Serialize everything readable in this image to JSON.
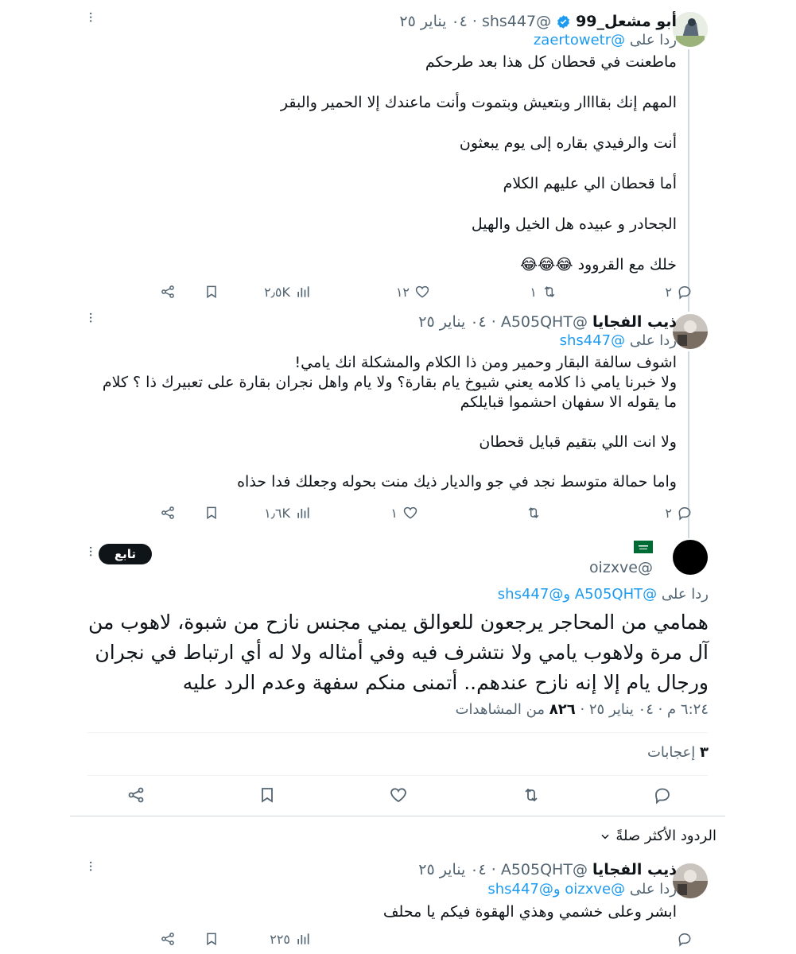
{
  "tweets": [
    {
      "name": "أبو مشعل_99",
      "handle": "@shs447",
      "date": "٠٤ يناير ٢٥",
      "reply_label": "ردا على",
      "reply_to": "@zaertowetr",
      "paragraphs": [
        "ماطعنت في قحطان كل هذا بعد طرحكم",
        "المهم إنك بقاااار وبتعيش وبتموت وأنت ماعندك إلا الحمير والبقر",
        "أنت والرفيدي بقاره إلى يوم يبعثون",
        "أما قحطان الي عليهم الكلام",
        "الجحادر و عبيده هل الخيل والهيل",
        "خلك مع القروود 😂😂😂"
      ],
      "replies": "٢",
      "retweets": "١",
      "likes": "١٢",
      "views": "٢٫٥K"
    },
    {
      "name": "ذيب الفجايا",
      "handle": "@A505QHT",
      "date": "٠٤ يناير ٢٥",
      "reply_label": "ردا على",
      "reply_to": "@shs447",
      "paragraphs": [
        "اشوف سالفة البقار وحمير ومن ذا الكلام والمشكلة انك يامي!\nولا خبرنا يامي ذا كلامه يعني شيوخ يام بقارة؟ ولا يام واهل نجران بقارة على تعبيرك ذا ؟ كلام ما يقوله الا سفهان احشموا قبايلكم",
        "ولا انت اللي بتقيم قبايل قحطان",
        "واما حمالة متوسط نجد في جو والديار ذيك منت بحوله وجعلك فدا حذاه"
      ],
      "replies": "٢",
      "retweets": "",
      "likes": "١",
      "views": "١٫٦K"
    }
  ],
  "main_tweet": {
    "flag": "🇸🇦",
    "handle": "@oizxve",
    "follow_label": "تابع",
    "reply_label": "ردا على",
    "reply_to": "@A505QHT و@shs447",
    "text": "همامي من المحاجر يرجعون للعوالق يمني مجنس نازح من شبوة، لاهوب من آل مرة ولاهوب يامي ولا نتشرف فيه وفي أمثاله ولا له أي ارتباط في نجران ورجال يام إلا إنه نازح عندهم.. أتمنى منكم سفهة وعدم الرد عليه",
    "time": "٦:٢٤ م · ٠٤ يناير ٢٥ ·",
    "views_count": "٨٢٦",
    "views_label": "من المشاهدات",
    "likes_count": "٣",
    "likes_label": "إعجابات"
  },
  "sort": {
    "label": "الردود الأكثر صلةً"
  },
  "bottom_reply": {
    "name": "ذيب الفجايا",
    "handle": "@A505QHT",
    "date": "٠٤ يناير ٢٥",
    "reply_label": "ردا على",
    "reply_to": "@oizxve و@shs447",
    "text": "ابشر وعلى خشمي وهذي الهقوة فيكم يا محلف",
    "views": "٢٢٥"
  },
  "colors": {
    "link": "#1d9bf0",
    "muted": "#536471",
    "text": "#0f1419",
    "verified": "#1d9bf0"
  }
}
